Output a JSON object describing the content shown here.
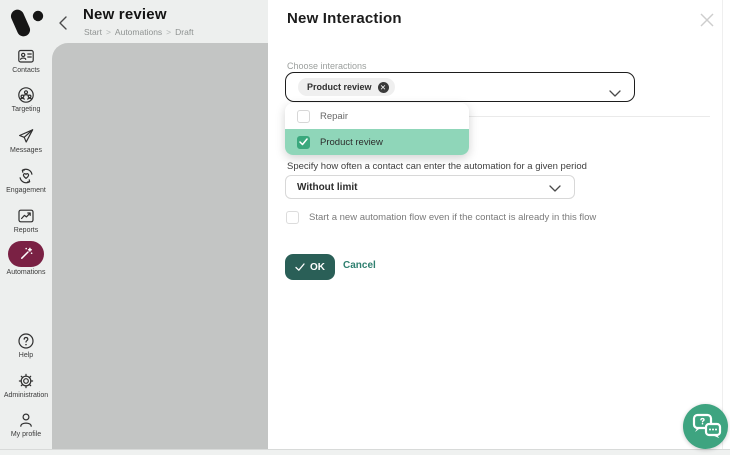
{
  "header": {
    "title": "New review",
    "breadcrumb": {
      "items": [
        "Start",
        "Automations",
        "Draft"
      ],
      "separator": ">"
    }
  },
  "sidebar": {
    "items": [
      {
        "id": "contacts",
        "label": "Contacts"
      },
      {
        "id": "targeting",
        "label": "Targeting"
      },
      {
        "id": "messages",
        "label": "Messages"
      },
      {
        "id": "engagement",
        "label": "Engagement"
      },
      {
        "id": "reports",
        "label": "Reports"
      },
      {
        "id": "automations",
        "label": "Automations",
        "active": true
      },
      {
        "id": "help",
        "label": "Help"
      },
      {
        "id": "administration",
        "label": "Administration"
      },
      {
        "id": "my-profile",
        "label": "My profile"
      }
    ]
  },
  "dialog": {
    "title": "New Interaction",
    "fields": {
      "interactions": {
        "label": "Choose interactions",
        "selected_tags": [
          "Product review"
        ],
        "remove_icon": "✕",
        "options": [
          {
            "label": "Repair",
            "checked": false
          },
          {
            "label": "Product review",
            "checked": true
          }
        ]
      },
      "frequency": {
        "label": "Specify how often a contact can enter the automation for a given period",
        "value": "Without limit"
      },
      "restart_flow": {
        "label": "Start a new automation flow even if the contact is already in this flow",
        "checked": false
      }
    },
    "actions": {
      "ok": "OK",
      "cancel": "Cancel"
    }
  },
  "colors": {
    "sidebar_bg": "#edefee",
    "canvas_bg": "#c3c5c4",
    "accent_maroon": "#7a2144",
    "ok_button_teal": "#2a5f57",
    "cancel_link_teal": "#2e7f6f",
    "dropdown_highlight_green": "#8fd6b9",
    "checkbox_green": "#3aa87d",
    "chat_button_green": "#3ea480"
  }
}
